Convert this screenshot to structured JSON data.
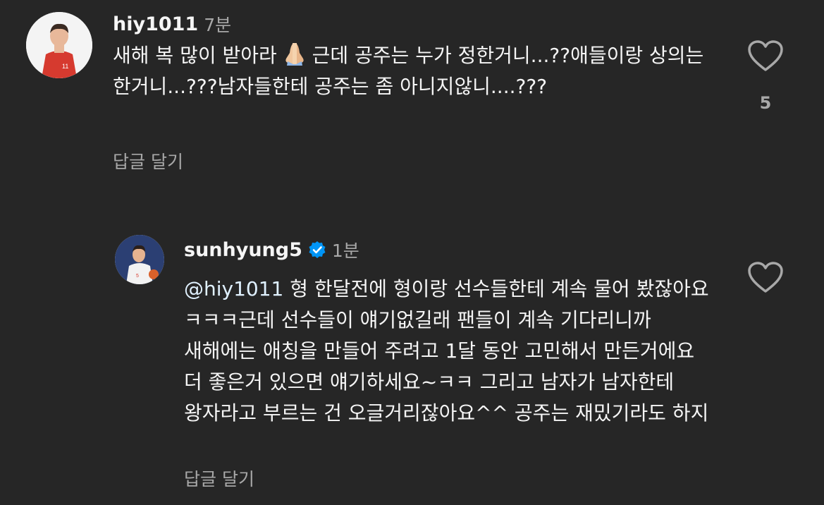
{
  "comment1": {
    "username": "hiy1011",
    "time": "7분",
    "text_a": "새해 복 많이 받아라",
    "emoji": "folded-hands",
    "text_b": "근데 공주는 누가 정한거니...??애들이랑 상의는 한거니...???남자들한테 공주는 좀 아니지않니....???",
    "reply_label": "답글 달기",
    "like_count": "5"
  },
  "comment2": {
    "username": "sunhyung5",
    "verified": true,
    "time": "1분",
    "mention": "@hiy1011",
    "text": " 형 한달전에 형이랑 선수들한테 계속 물어 봤잖아요 ㅋㅋㅋ근데 선수들이 얘기없길래 팬들이 계속 기다리니까 새해에는 애칭을 만들어 주려고 1달 동안 고민해서 만든거에요 더 좋은거 있으면 얘기하세요~ㅋㅋ 그리고 남자가 남자한테 왕자라고 부르는 건 오글거리잖아요^^ 공주는 재밌기라도 하지",
    "reply_label": "답글 달기"
  },
  "colors": {
    "background": "#262626",
    "primary_text": "#f5f5f5",
    "secondary_text": "#a8a8a8",
    "verified_blue": "#0095f6"
  }
}
